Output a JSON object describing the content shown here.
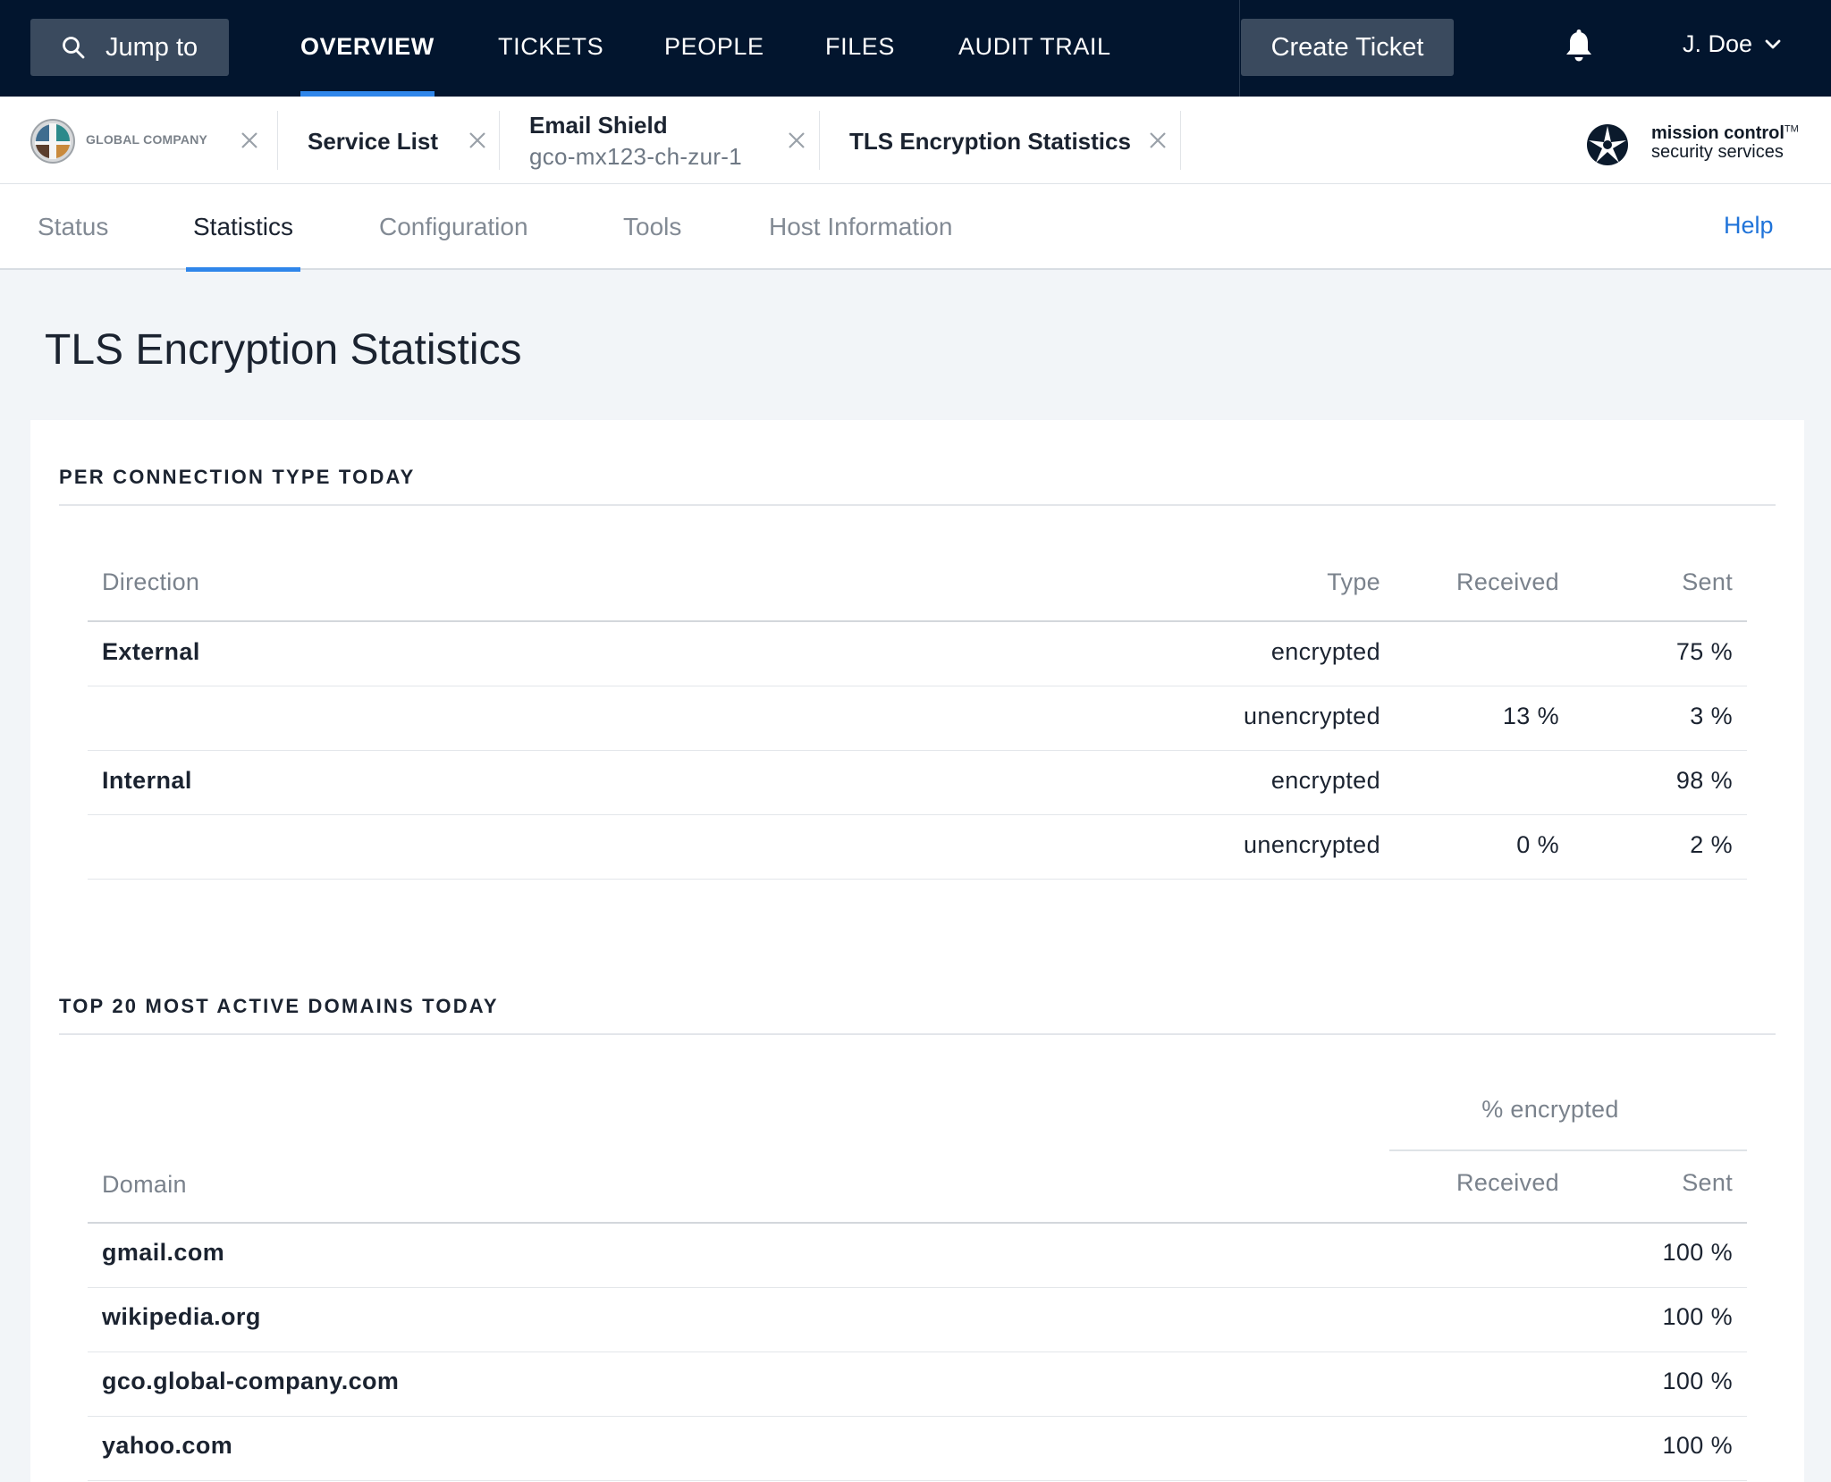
{
  "topnav": {
    "jump_label": "Jump to",
    "links": [
      "OVERVIEW",
      "TICKETS",
      "PEOPLE",
      "FILES",
      "AUDIT TRAIL"
    ],
    "create_label": "Create Ticket",
    "user_name": "J. Doe"
  },
  "tabs": {
    "company_name": "GLOBAL COMPANY",
    "service_list": "Service List",
    "email_shield_title": "Email Shield",
    "email_shield_host": "gco-mx123-ch-zur-1",
    "tls_stats": "TLS Encryption Statistics",
    "brand_line1": "mission control",
    "brand_tm": "TM",
    "brand_line2": "security services"
  },
  "subnav": {
    "items": [
      "Status",
      "Statistics",
      "Configuration",
      "Tools",
      "Host Information"
    ],
    "help": "Help"
  },
  "page": {
    "title": "TLS Encryption Statistics"
  },
  "connection_table": {
    "section_title": "PER CONNECTION TYPE TODAY",
    "headers": {
      "direction": "Direction",
      "type": "Type",
      "received": "Received",
      "sent": "Sent"
    },
    "rows": [
      {
        "direction": "External",
        "type": "encrypted",
        "received": "",
        "sent": "75 %"
      },
      {
        "direction": "",
        "type": "unencrypted",
        "received": "13 %",
        "sent": "3 %"
      },
      {
        "direction": "Internal",
        "type": "encrypted",
        "received": "",
        "sent": "98 %"
      },
      {
        "direction": "",
        "type": "unencrypted",
        "received": "0 %",
        "sent": "2 %"
      }
    ]
  },
  "domains_table": {
    "section_title": "TOP 20 MOST ACTIVE DOMAINS TODAY",
    "group_header": "% encrypted",
    "headers": {
      "domain": "Domain",
      "received": "Received",
      "sent": "Sent"
    },
    "rows": [
      {
        "domain": "gmail.com",
        "received": "",
        "sent": "100 %"
      },
      {
        "domain": "wikipedia.org",
        "received": "",
        "sent": "100 %"
      },
      {
        "domain": "gco.global-company.com",
        "received": "",
        "sent": "100 %"
      },
      {
        "domain": "yahoo.com",
        "received": "",
        "sent": "100 %"
      }
    ]
  },
  "colors": {
    "nav_bg": "#02152e",
    "button_bg": "#3a4a5e",
    "accent": "#2f86ea",
    "link": "#1f73d9"
  }
}
